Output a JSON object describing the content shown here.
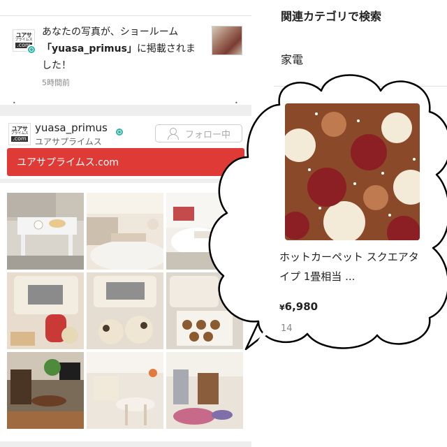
{
  "notification": {
    "message_pre": "あなたの写真が、ショールーム",
    "message_user": "「yuasa_primus」",
    "message_post": "に掲載されました！",
    "time": "5時間前"
  },
  "logo": {
    "line1": "ユアサ",
    "line2": "プライムス",
    "line3": ".com"
  },
  "profile": {
    "name": "yuasa_primus",
    "subtitle": "ユアサプライムス",
    "follow_label": "フォロー中",
    "shop_banner": "ユアサプライムス.com"
  },
  "related": {
    "title": "関連カテゴリで検索",
    "category": "家電"
  },
  "product": {
    "name": "ホットカーペット スクエアタイプ 1畳相当 ...",
    "price_symbol": "¥",
    "price": "6,980",
    "peek": "14"
  },
  "colors": {
    "shop_red": "#e03a37",
    "badge_teal": "#2db2a4",
    "carpet_brown": "#8a4a2a"
  }
}
